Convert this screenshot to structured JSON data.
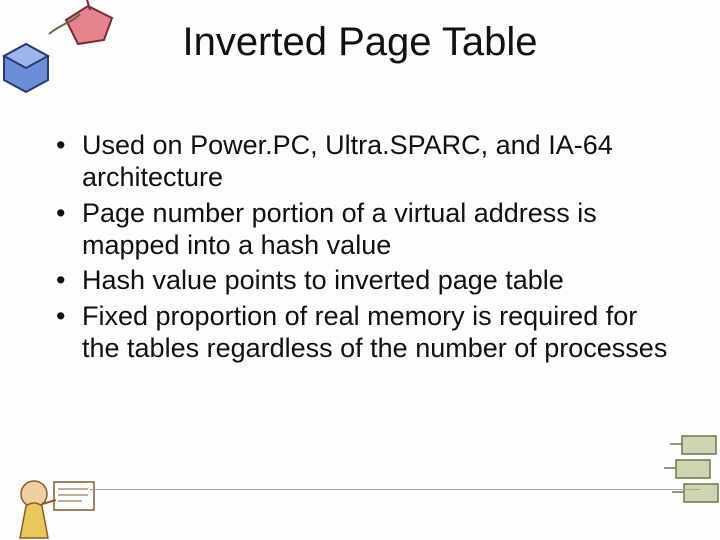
{
  "title": "Inverted Page Table",
  "bullets": [
    "Used on Power.PC, Ultra.SPARC, and IA-64 architecture",
    "Page number portion of a virtual address is mapped into a hash value",
    "Hash value points to inverted page table",
    "Fixed proportion of real memory is required for the tables regardless of the number of processes"
  ]
}
